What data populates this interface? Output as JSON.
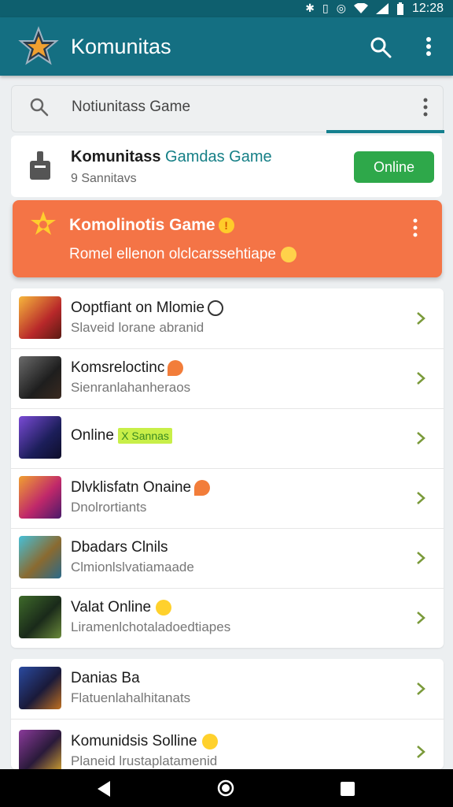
{
  "status": {
    "time": "12:28"
  },
  "appbar": {
    "title": "Komunitas"
  },
  "search": {
    "placeholder": "Notiunitass Game"
  },
  "community": {
    "name": "Komunitass",
    "name_accent": "Gamdas Game",
    "subtitle": "9 Sannitavs",
    "online_label": "Online"
  },
  "banner": {
    "title": "Komolinotis Game",
    "subtitle": "Romel ellenon olclcarssehtiape"
  },
  "list1": [
    {
      "title": "Ooptfiant on Mlomie",
      "subtitle": "Slaveid lorane abranid",
      "decor": "circle"
    },
    {
      "title": "Komsreloctinc",
      "subtitle": "Sienranlahanheraos",
      "decor": "bubble"
    },
    {
      "title": "Online",
      "tag": "X Sannas",
      "subtitle": "",
      "decor": "tag"
    },
    {
      "title": "Dlvklisfatn Onaine",
      "subtitle": "Dnolrortiants",
      "decor": "bubble"
    },
    {
      "title": "Dbadars Clnils",
      "subtitle": "Clmionlslvatiamaade",
      "decor": ""
    },
    {
      "title": "Valat Online",
      "subtitle": "Liramenlchotaladoedtiapes",
      "decor": "smile"
    }
  ],
  "list2": [
    {
      "title": "Danias Ba",
      "subtitle": "Flatuenlahalhitanats",
      "decor": ""
    },
    {
      "title": "Komunidsis Solline",
      "subtitle": "Planeid lrustaplatamenid",
      "decor": "smile"
    }
  ],
  "colors": {
    "appbar": "#146f82",
    "accent_teal": "#157f86",
    "online_green": "#2ea84a",
    "banner_orange": "#f47446"
  },
  "icons": [
    "bluetooth-icon",
    "vibrate-icon",
    "alarm-icon",
    "wifi-icon",
    "signal-icon",
    "battery-icon",
    "search-icon",
    "more-vert-icon",
    "back-icon",
    "home-icon",
    "recents-icon"
  ]
}
